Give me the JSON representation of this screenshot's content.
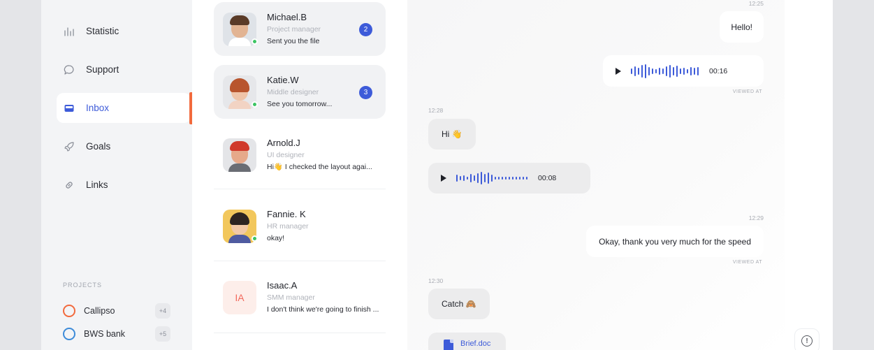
{
  "sidebar": {
    "items": [
      {
        "label": "Statistic",
        "icon": "bar-chart-icon"
      },
      {
        "label": "Support",
        "icon": "chat-bubble-icon"
      },
      {
        "label": "Inbox",
        "icon": "inbox-icon",
        "active": true
      },
      {
        "label": "Goals",
        "icon": "rocket-icon"
      },
      {
        "label": "Links",
        "icon": "link-icon"
      }
    ],
    "projects_title": "PROJECTS",
    "projects": [
      {
        "name": "Callipso",
        "count": "+4",
        "color": "#f26a3d"
      },
      {
        "name": "BWS bank",
        "count": "+5",
        "color": "#3d8bd9"
      }
    ]
  },
  "conversations": [
    {
      "name": "Michael.B",
      "role": "Project manager",
      "message": "Sent you the file",
      "unread": "2",
      "online": true
    },
    {
      "name": "Katie.W",
      "role": "Middle designer",
      "message": "See you tomorrow...",
      "unread": "3",
      "online": true
    },
    {
      "name": "Arnold.J",
      "role": "UI designer",
      "message": "Hi👋 I checked the layout agai...",
      "online": false
    },
    {
      "name": "Fannie. K",
      "role": "HR manager",
      "message": "okay!",
      "online": true
    },
    {
      "name": "Isaac.A",
      "role": "SMM manager",
      "message": "I don't think we're going to finish ...",
      "initials": "IA",
      "online": false
    }
  ],
  "chat": {
    "time_1": "12:25",
    "msg_hello": "Hello!",
    "voice_out_duration": "00:16",
    "viewed_1": "VIEWED AT",
    "time_2": "12:28",
    "msg_hi": "Hi 👋",
    "voice_in_duration": "00:08",
    "time_3": "12:29",
    "msg_thanks": "Okay, thank you very much for the speed",
    "viewed_2": "VIEWED AT",
    "time_4": "12:30",
    "msg_catch": "Catch 🙈",
    "file_name": "Brief.doc"
  },
  "colors": {
    "accent": "#3d5bd9",
    "active_indicator": "#f26a3d",
    "online": "#3cc463"
  }
}
